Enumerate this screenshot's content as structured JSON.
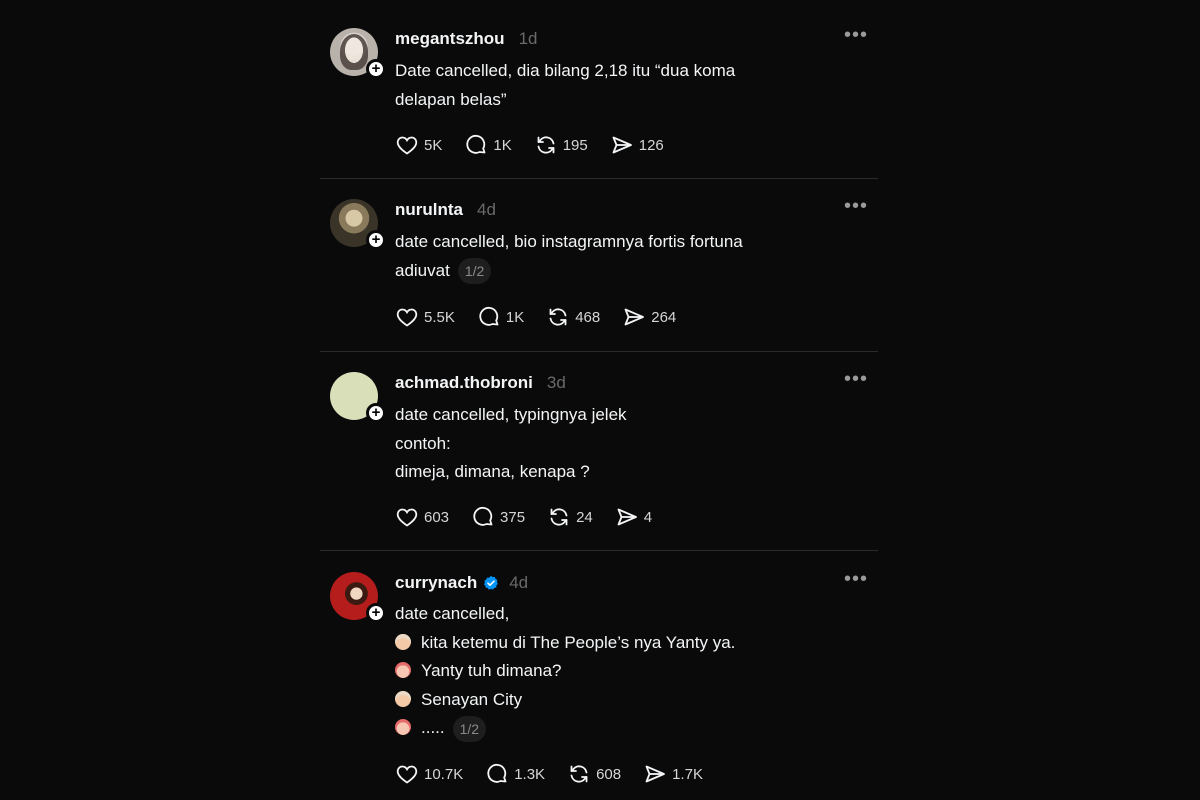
{
  "posts": [
    {
      "username": "megantszhou",
      "time": "1d",
      "verified": false,
      "more": "•••",
      "lines": [
        "Date cancelled, dia bilang 2,18 itu “dua koma",
        "delapan belas”"
      ],
      "page_indicator": null,
      "likes": "5K",
      "comments": "1K",
      "reposts": "195",
      "shares": "126"
    },
    {
      "username": "nurulnta",
      "time": "4d",
      "verified": false,
      "more": "•••",
      "lines": [
        "date cancelled, bio instagramnya fortis fortuna",
        "adiuvat"
      ],
      "page_indicator": "1/2",
      "likes": "5.5K",
      "comments": "1K",
      "reposts": "468",
      "shares": "264"
    },
    {
      "username": "achmad.thobroni",
      "time": "3d",
      "verified": false,
      "more": "•••",
      "lines": [
        "date cancelled, typingnya jelek",
        "contoh:",
        "dimeja, dimana, kenapa ?"
      ],
      "page_indicator": null,
      "likes": "603",
      "comments": "375",
      "reposts": "24",
      "shares": "4"
    },
    {
      "username": "currynach",
      "time": "4d",
      "verified": true,
      "more": "•••",
      "lines": [
        "date cancelled,",
        "kita ketemu di The People’s nya Yanty ya.",
        "Yanty tuh dimana?",
        "Senayan City",
        "....."
      ],
      "line_emojis": [
        "",
        "boy-emoji",
        "girl-emoji",
        "boy-emoji",
        "girl-emoji"
      ],
      "page_indicator": "1/2",
      "likes": "10.7K",
      "comments": "1.3K",
      "reposts": "608",
      "shares": "1.7K"
    }
  ],
  "colors": {
    "background": "#0a0a0a",
    "text": "#f3f5f7",
    "muted": "#6a6a6a",
    "divider": "#2b2b2b",
    "verified": "#0095f6"
  },
  "icons": {
    "like": "heart-icon",
    "comment": "comment-bubble-icon",
    "repost": "repost-icon",
    "share": "send-icon",
    "follow": "plus-icon",
    "more": "more-options-icon",
    "verified": "verified-badge-icon"
  }
}
